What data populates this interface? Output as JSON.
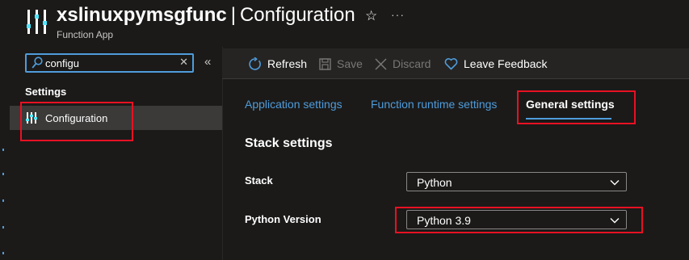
{
  "header": {
    "resource_name": "xslinuxpymsgfunc",
    "separator": "|",
    "blade_name": "Configuration",
    "subtitle": "Function App",
    "star_glyph": "☆",
    "more_glyph": "···",
    "logo_icon": "function-app-sliders-icon"
  },
  "sidebar": {
    "search": {
      "value": "configu",
      "placeholder": "",
      "clear_glyph": "✕",
      "icon": "search-icon"
    },
    "collapse_glyph": "«",
    "group_label": "Settings",
    "items": [
      {
        "label": "Configuration",
        "icon": "configuration-sliders-icon",
        "selected": true
      }
    ]
  },
  "toolbar": {
    "refresh_label": "Refresh",
    "save_label": "Save",
    "discard_label": "Discard",
    "feedback_label": "Leave Feedback"
  },
  "tabs": [
    {
      "label": "Application settings",
      "active": false
    },
    {
      "label": "Function runtime settings",
      "active": false
    },
    {
      "label": "General settings",
      "active": true
    }
  ],
  "stack_settings": {
    "section_title": "Stack settings",
    "stack_label": "Stack",
    "stack_value": "Python",
    "version_label": "Python Version",
    "version_value": "Python 3.9"
  },
  "colors": {
    "background": "#1b1a19",
    "accent": "#4f9cdb",
    "highlight_box": "#e81123",
    "selected_nav": "#3b3a39",
    "toolbar": "#252423",
    "disabled_text": "#797775"
  }
}
